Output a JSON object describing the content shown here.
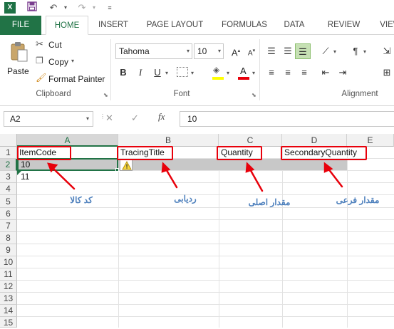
{
  "quick_access": {
    "app_icon": "X",
    "save": "save-icon",
    "undo": "undo-icon",
    "redo": "redo-icon"
  },
  "tabs": [
    "FILE",
    "HOME",
    "INSERT",
    "PAGE LAYOUT",
    "FORMULAS",
    "DATA",
    "REVIEW",
    "VIEW"
  ],
  "clipboard": {
    "paste": "Paste",
    "cut": "Cut",
    "copy": "Copy",
    "format_painter": "Format Painter",
    "group_label": "Clipboard"
  },
  "font": {
    "name": "Tahoma",
    "size": "10",
    "bold": "B",
    "italic": "I",
    "underline": "U",
    "font_color_glyph": "A",
    "group_label": "Font"
  },
  "alignment": {
    "group_label": "Alignment"
  },
  "formula_bar": {
    "name_box": "A2",
    "fx": "fx",
    "value": "10",
    "cancel": "✕",
    "enter": "✓"
  },
  "columns": [
    "A",
    "B",
    "C",
    "D",
    "E"
  ],
  "rows": [
    "1",
    "2",
    "3",
    "4",
    "5",
    "6",
    "7",
    "8",
    "9",
    "10",
    "11",
    "12",
    "13",
    "14",
    "15"
  ],
  "cells": {
    "a1": "ItemCode",
    "b1": "TracingTitle",
    "c1": "Quantity",
    "d1": "SecondaryQuantity",
    "a2": "10",
    "a3": "11"
  },
  "annotations": {
    "item_code": "کد کالا",
    "tracing": "ردیابی",
    "quantity": "مقدار اصلی",
    "secondary": "مقدار فرعی"
  },
  "colors": {
    "excel_green": "#217346",
    "annotation_red": "#e8000b",
    "annotation_blue": "#4f81bd"
  }
}
